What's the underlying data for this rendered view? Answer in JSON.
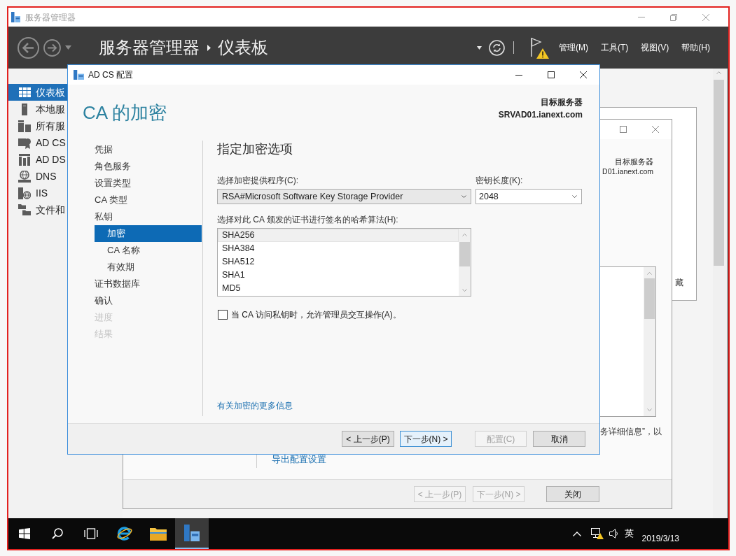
{
  "window": {
    "title": "服务器管理器"
  },
  "toolbar": {
    "breadcrumb": [
      "服务器管理器",
      "仪表板"
    ],
    "menus": [
      "管理(M)",
      "工具(T)",
      "视图(V)",
      "帮助(H)"
    ]
  },
  "sidebar": {
    "items": [
      {
        "kind": "dashboard",
        "label": "仪表板",
        "selected": true
      },
      {
        "kind": "local",
        "label": "本地服",
        "selected": false
      },
      {
        "kind": "all",
        "label": "所有服",
        "selected": false
      },
      {
        "kind": "adcs",
        "label": "AD CS",
        "selected": false
      },
      {
        "kind": "adds",
        "label": "AD DS",
        "selected": false
      },
      {
        "kind": "dns",
        "label": "DNS",
        "selected": false
      },
      {
        "kind": "iis",
        "label": "IIS",
        "selected": false
      },
      {
        "kind": "files",
        "label": "文件和",
        "selected": false
      }
    ]
  },
  "dashboard": {
    "tile_link": "藏"
  },
  "background_wizard": {
    "target_server_label": "目标服务器",
    "target_server": "D01.ianext.com",
    "result_text": "务详细信息”，以",
    "link": "导出配置设置",
    "buttons": [
      {
        "label": "< 上一步(P)",
        "disabled": true
      },
      {
        "label": "下一步(N) >",
        "disabled": true
      },
      {
        "label": "关闭",
        "disabled": false
      }
    ]
  },
  "dialog": {
    "title": "AD CS 配置",
    "heading": "CA 的加密",
    "target_server_label": "目标服务器",
    "target_server": "SRVAD01.ianext.com",
    "nav": [
      {
        "label": "凭据",
        "selected": false,
        "disabled": false
      },
      {
        "label": "角色服务",
        "selected": false,
        "disabled": false
      },
      {
        "label": "设置类型",
        "selected": false,
        "disabled": false
      },
      {
        "label": "CA 类型",
        "selected": false,
        "disabled": false
      },
      {
        "label": "私钥",
        "selected": false,
        "disabled": false,
        "children": [
          {
            "label": "加密",
            "selected": true,
            "disabled": false
          },
          {
            "label": "CA 名称",
            "selected": false,
            "disabled": false
          },
          {
            "label": "有效期",
            "selected": false,
            "disabled": false
          }
        ]
      },
      {
        "label": "证书数据库",
        "selected": false,
        "disabled": false
      },
      {
        "label": "确认",
        "selected": false,
        "disabled": false
      },
      {
        "label": "进度",
        "selected": false,
        "disabled": true
      },
      {
        "label": "结果",
        "selected": false,
        "disabled": true
      }
    ],
    "section_title": "指定加密选项",
    "provider": {
      "label": "选择加密提供程序(C):",
      "value": "RSA#Microsoft Software Key Storage Provider"
    },
    "key_length": {
      "label": "密钥长度(K):",
      "value": "2048"
    },
    "hash": {
      "label": "选择对此 CA 颁发的证书进行签名的哈希算法(H):",
      "options": [
        {
          "label": "SHA256",
          "selected": true
        },
        {
          "label": "SHA384",
          "selected": false
        },
        {
          "label": "SHA512",
          "selected": false
        },
        {
          "label": "SHA1",
          "selected": false
        },
        {
          "label": "MD5",
          "selected": false
        }
      ]
    },
    "interactive": {
      "label": "当 CA 访问私钥时，允许管理员交互操作(A)。",
      "checked": false
    },
    "more_info_link": "有关加密的更多信息",
    "buttons": [
      {
        "label": "< 上一步(P)",
        "disabled": false,
        "focused": false
      },
      {
        "label": "下一步(N) >",
        "disabled": false,
        "focused": true
      },
      {
        "label": "配置(C)",
        "disabled": true,
        "focused": false
      },
      {
        "label": "取消",
        "disabled": false,
        "focused": false
      }
    ]
  },
  "taskbar": {
    "apps": [
      {
        "kind": "browser",
        "selected": false
      },
      {
        "kind": "folder",
        "selected": false
      },
      {
        "kind": "servermanager",
        "selected": true
      }
    ],
    "ime": "英",
    "date": "2019/3/13"
  }
}
